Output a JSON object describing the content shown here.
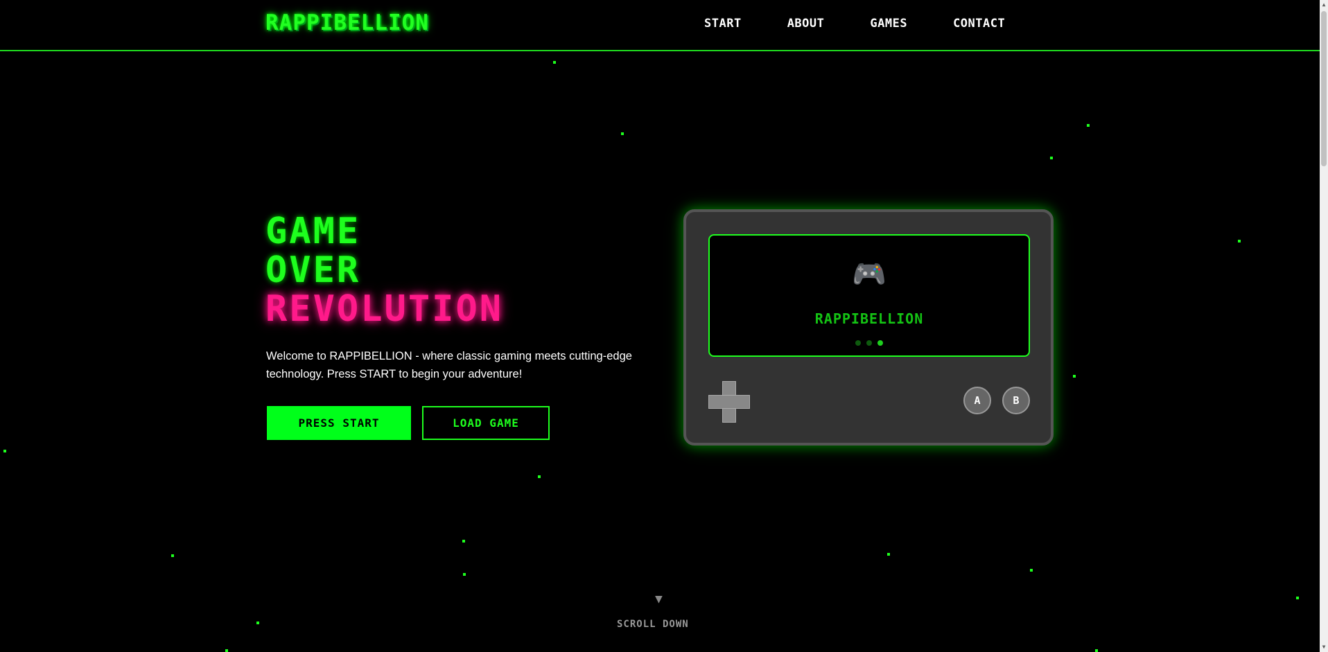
{
  "header": {
    "logo": "RAPPIBELLION",
    "nav": [
      "START",
      "ABOUT",
      "GAMES",
      "CONTACT"
    ]
  },
  "hero": {
    "title_line1": "GAME",
    "title_line2": "OVER",
    "title_line3": "REVOLUTION",
    "description": "Welcome to RAPPIBELLION - where classic gaming meets cutting-edge technology. Press START to begin your adventure!",
    "primary_button": "PRESS START",
    "secondary_button": "LOAD GAME"
  },
  "console": {
    "screen_icon": "🎮",
    "screen_icon_name": "game-controller-icon",
    "screen_title": "RAPPIBELLION",
    "dots_active_index": 2,
    "button_a": "A",
    "button_b": "B"
  },
  "scroll": {
    "arrow": "▼",
    "label": "SCROLL DOWN"
  },
  "colors": {
    "accent_green": "#1eff1e",
    "accent_pink": "#ff1a8a",
    "background": "#000000",
    "console_body": "#333333"
  }
}
